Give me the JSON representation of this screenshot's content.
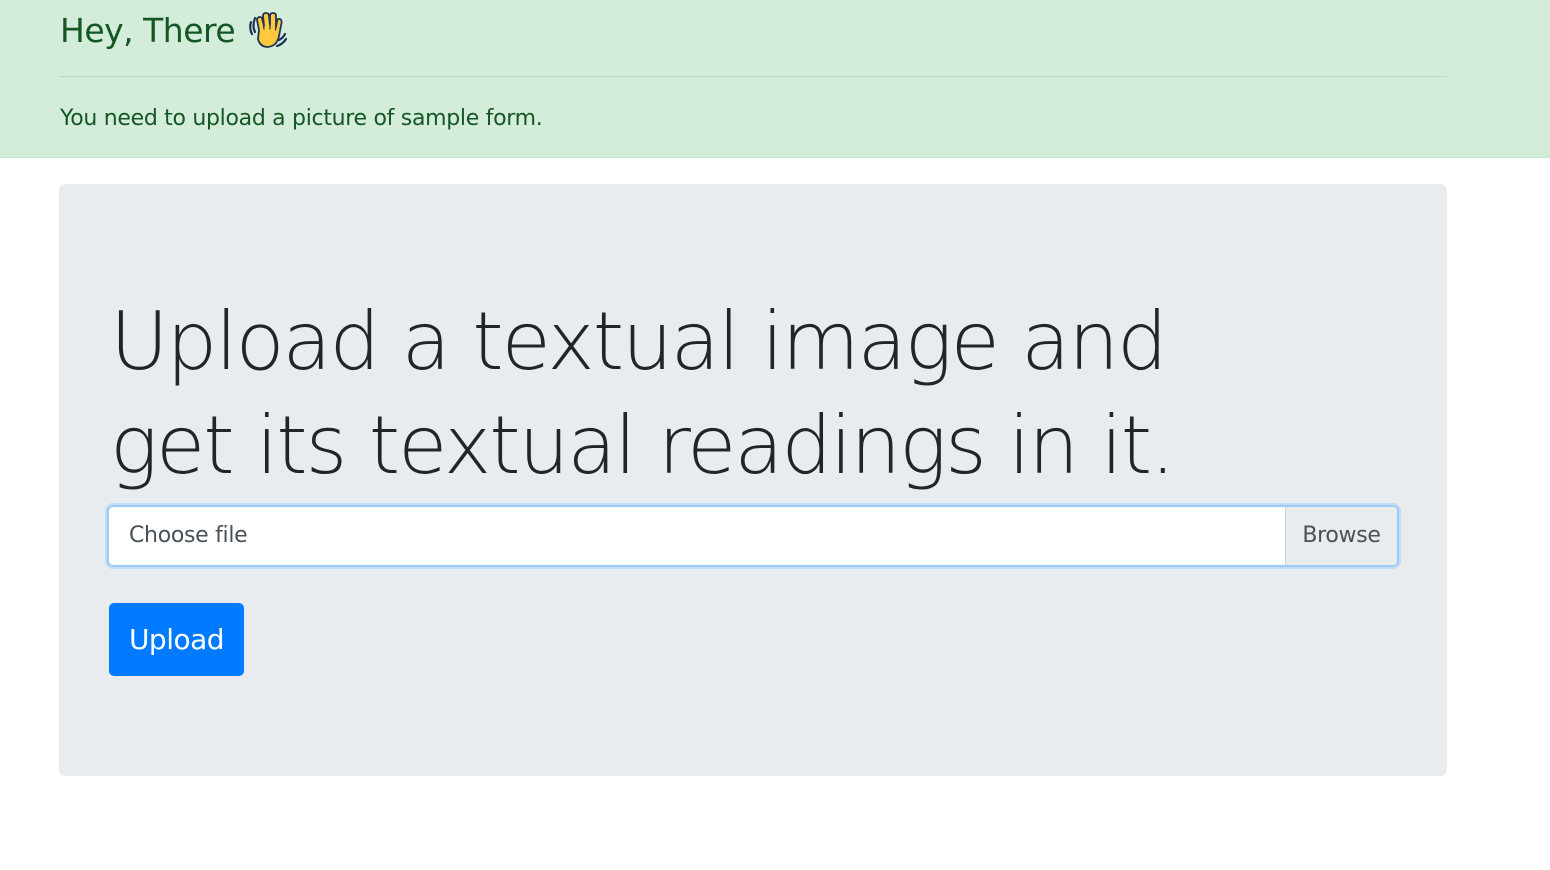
{
  "alert": {
    "heading": "Hey, There",
    "heading_icon": "waving-hand-icon",
    "message": "You need to upload a picture of sample form."
  },
  "jumbotron": {
    "title": "Upload a textual image and get its textual readings in it.",
    "file_input": {
      "placeholder": "Choose file",
      "browse_label": "Browse"
    },
    "upload_label": "Upload"
  },
  "colors": {
    "alert_bg": "#d4edda",
    "alert_text": "#155724",
    "jumbotron_bg": "#e9ecef",
    "primary": "#007bff",
    "focus_border": "#9ecbf4"
  }
}
